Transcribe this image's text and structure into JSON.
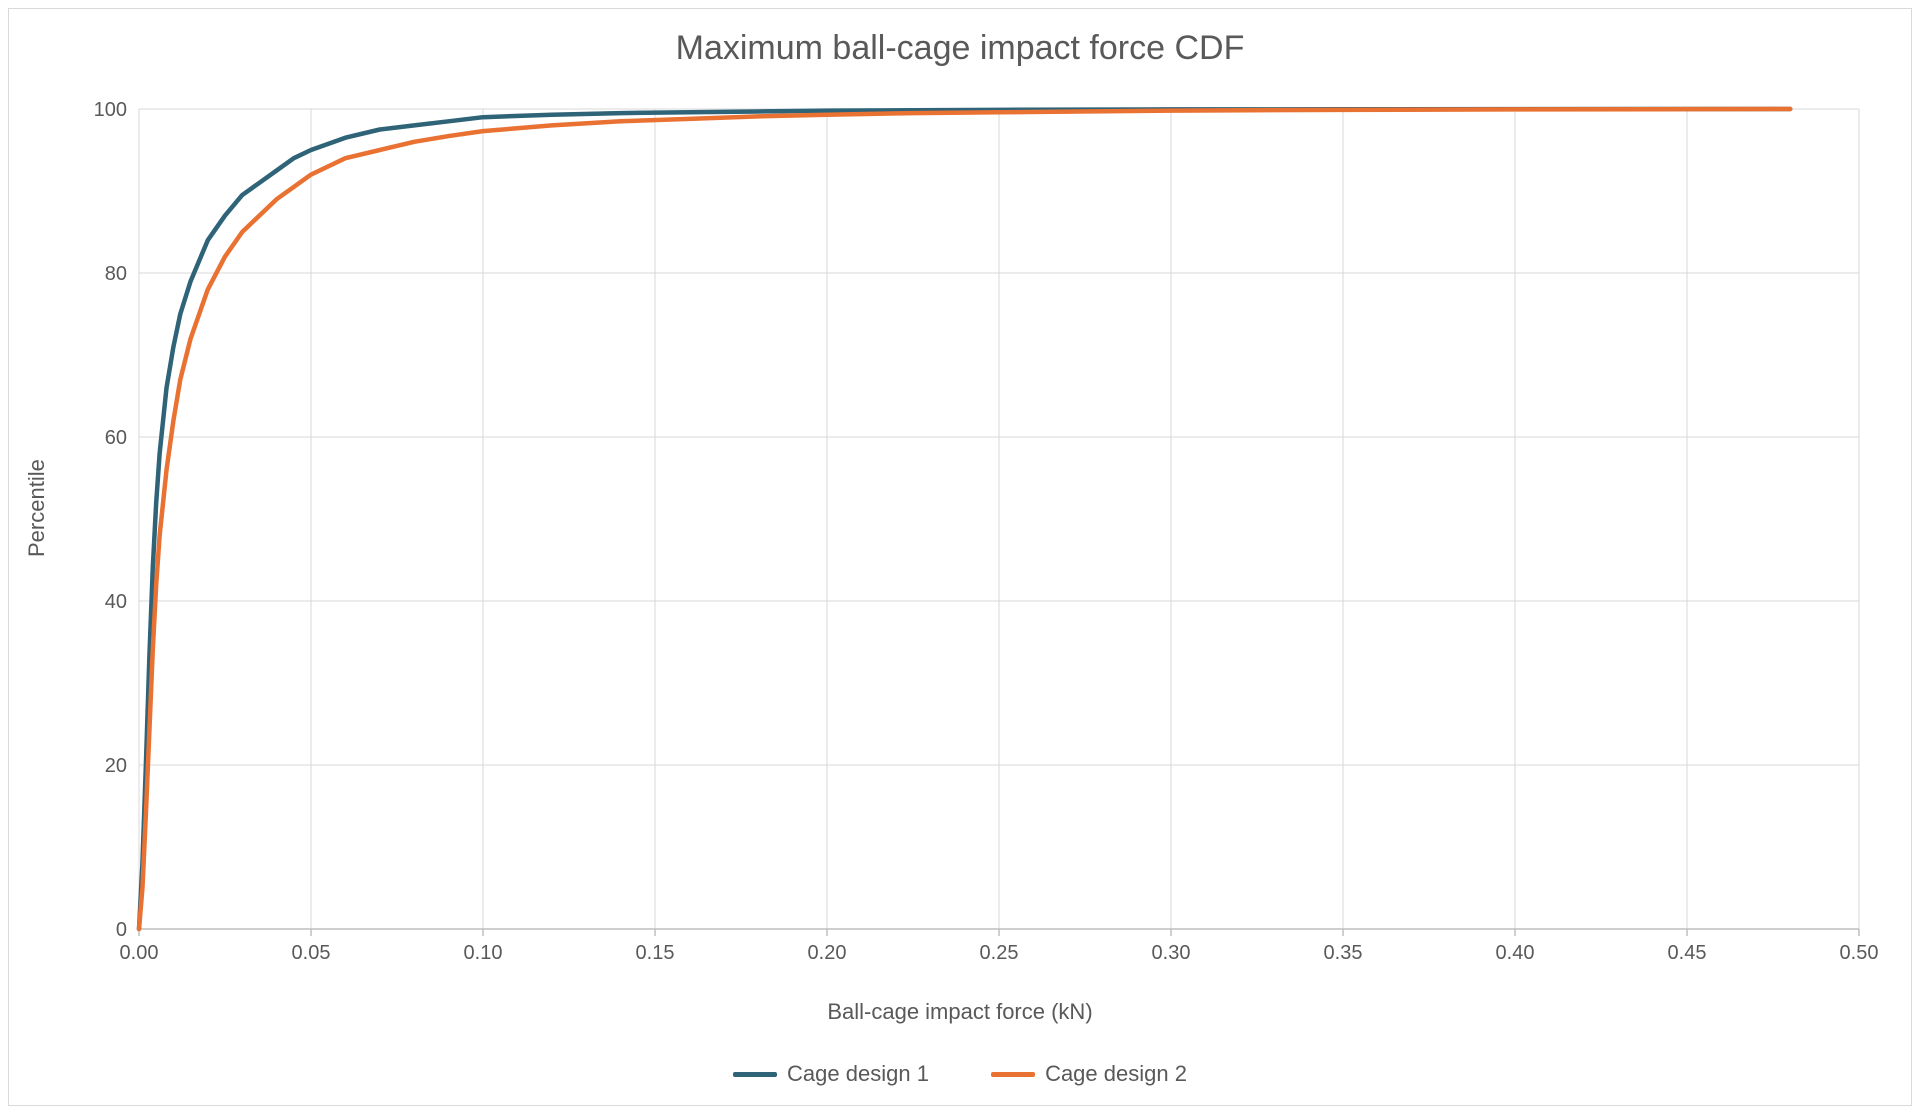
{
  "chart_data": {
    "type": "line",
    "title": "Maximum ball-cage impact force CDF",
    "xlabel": "Ball-cage impact force (kN)",
    "ylabel": "Percentile",
    "xlim": [
      0.0,
      0.5
    ],
    "ylim": [
      0,
      100
    ],
    "xticks": [
      0.0,
      0.05,
      0.1,
      0.15,
      0.2,
      0.25,
      0.3,
      0.35,
      0.4,
      0.45,
      0.5
    ],
    "xtick_labels": [
      "0.00",
      "0.05",
      "0.10",
      "0.15",
      "0.20",
      "0.25",
      "0.30",
      "0.35",
      "0.40",
      "0.45",
      "0.50"
    ],
    "yticks": [
      0,
      20,
      40,
      60,
      80,
      100
    ],
    "grid": true,
    "legend_position": "bottom",
    "series": [
      {
        "name": "Cage design 1",
        "color": "#2e6378",
        "x": [
          0.0,
          0.001,
          0.002,
          0.003,
          0.004,
          0.005,
          0.006,
          0.008,
          0.01,
          0.012,
          0.015,
          0.02,
          0.025,
          0.03,
          0.035,
          0.04,
          0.045,
          0.05,
          0.06,
          0.07,
          0.08,
          0.09,
          0.1,
          0.12,
          0.14,
          0.16,
          0.18,
          0.2,
          0.225,
          0.25,
          0.3,
          0.35,
          0.4,
          0.45,
          0.48
        ],
        "y": [
          0,
          8,
          20,
          33,
          44,
          52,
          58,
          66,
          71,
          75,
          79,
          84,
          87,
          89.5,
          91,
          92.5,
          94,
          95,
          96.5,
          97.5,
          98,
          98.5,
          99,
          99.3,
          99.5,
          99.6,
          99.7,
          99.8,
          99.85,
          99.9,
          99.95,
          99.97,
          99.99,
          100,
          100
        ]
      },
      {
        "name": "Cage design 2",
        "color": "#e97132",
        "x": [
          0.0,
          0.001,
          0.002,
          0.003,
          0.004,
          0.005,
          0.006,
          0.008,
          0.01,
          0.012,
          0.015,
          0.02,
          0.025,
          0.03,
          0.035,
          0.04,
          0.045,
          0.05,
          0.06,
          0.07,
          0.08,
          0.09,
          0.1,
          0.12,
          0.14,
          0.16,
          0.18,
          0.2,
          0.225,
          0.25,
          0.3,
          0.35,
          0.4,
          0.45,
          0.48
        ],
        "y": [
          0,
          5,
          14,
          24,
          34,
          42,
          48,
          56,
          62,
          67,
          72,
          78,
          82,
          85,
          87,
          89,
          90.5,
          92,
          94,
          95,
          96,
          96.7,
          97.3,
          98,
          98.5,
          98.8,
          99.1,
          99.3,
          99.5,
          99.6,
          99.8,
          99.9,
          99.95,
          99.98,
          100
        ]
      }
    ]
  },
  "legend": {
    "items": [
      {
        "label": "Cage design 1",
        "color": "#2e6378"
      },
      {
        "label": "Cage design 2",
        "color": "#e97132"
      }
    ]
  },
  "colors": {
    "grid": "#d9d9d9",
    "axis": "#bfbfbf",
    "text": "#595959"
  }
}
